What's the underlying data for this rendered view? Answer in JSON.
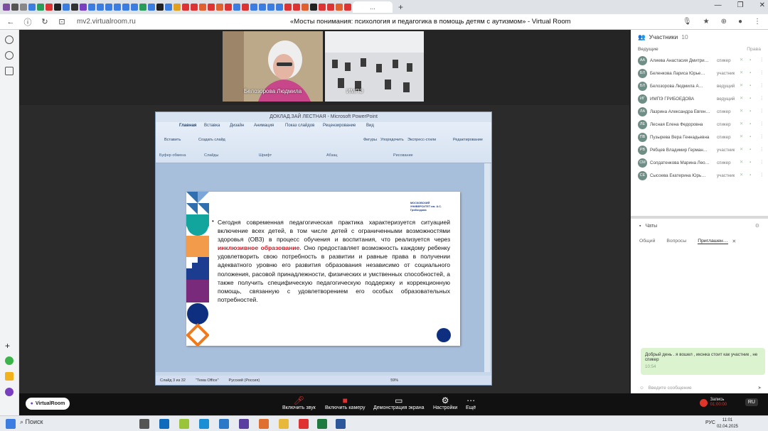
{
  "browser": {
    "tab_active_label": "…",
    "url": "mv2.virtualroom.ru",
    "page_title": "«Мосты понимания: психология и педагогика в помощь детям с аутизмом» - Virtual Room"
  },
  "video_tiles": [
    {
      "name": "Белозорова Людмила"
    },
    {
      "name": "ИМПЭ"
    }
  ],
  "ppt": {
    "window_title": "ДОКЛАД.ЗАЙ ЛЕСТНАЯ - Microsoft PowerPoint",
    "ribbon_tabs": [
      "Главная",
      "Вставка",
      "Дизайн",
      "Анимация",
      "Показ слайдов",
      "Рецензирование",
      "Вид"
    ],
    "ribbon_groups": [
      "Буфер обмена",
      "Слайды",
      "Шрифт",
      "Абзац",
      "Рисование",
      "Редактирование"
    ],
    "ribbon_buttons": {
      "paste": "Вставить",
      "create_slide": "Создать слайд",
      "figures": "Фигуры",
      "arrange": "Упорядочить",
      "express": "Экспресс-стили",
      "editing": "Редактирование"
    },
    "slide_logo": "МОСКОВСКИЙ УНИВЕРСИТЕТ им. А.С. Грибоедова",
    "slide_text_1": "Сегодня современная педагогическая практика характеризуется ситуацией включение всех детей, в том числе детей с ограниченными возможностями здоровья (ОВЗ) в процесс обучения и воспитания, что реализуется через ",
    "slide_text_highlight": "инклюзивное образование",
    "slide_text_2": ". Оно предоставляет возможность каждому ребенку удовлетворить свою потребность в развитии и равные права в получении адекватного уровню его развития образования независимо от социального положения, расовой принадлежности, физических и умственных способностей, а также получить специфическую педагогическую поддержку и коррекционную помощь, связанную с удовлетворением его особых образовательных потребностей.",
    "status": {
      "slide": "Слайд 3 из 32",
      "theme": "\"Тема Office\"",
      "lang": "Русский (Россия)",
      "zoom": "59%"
    }
  },
  "participants": {
    "title": "Участники",
    "count": "10",
    "section": "Ведущие",
    "section_right": "Права",
    "list": [
      {
        "initials": "АА",
        "name": "Алиева Анастасия Дмитри…",
        "role": "спикер",
        "color": "#6f8e86"
      },
      {
        "initials": "БЛ",
        "name": "Беленкова Лариса Юрье…",
        "role": "участник",
        "color": "#6f8e86"
      },
      {
        "initials": "БЛ",
        "name": "Белозорова Людмила А…",
        "role": "ведущий",
        "color": "#6f8e86"
      },
      {
        "initials": "ИГ",
        "name": "ИМПЭ ГРИБОЕДОВА",
        "role": "ведущий",
        "color": "#6f8e86"
      },
      {
        "initials": "ЛА",
        "name": "Лазрина Александра Евген…",
        "role": "спикер",
        "color": "#6f8e86"
      },
      {
        "initials": "ЛЕ",
        "name": "Лесная Елена Федоровна",
        "role": "спикер",
        "color": "#6f8e86"
      },
      {
        "initials": "ПВ",
        "name": "Пузырева Вера Геннадьевна",
        "role": "спикер",
        "color": "#6f8e86"
      },
      {
        "initials": "РВ",
        "name": "Рябцев Владимир Герман…",
        "role": "участник",
        "color": "#6f8e86"
      },
      {
        "initials": "СМ",
        "name": "Солдатенкова Марина Лео…",
        "role": "спикер",
        "color": "#6f8e86"
      },
      {
        "initials": "СЕ",
        "name": "Сысоева Екатерина Юрь…",
        "role": "участник",
        "color": "#6f8e86"
      }
    ]
  },
  "chat": {
    "title": "Чаты",
    "tabs": [
      "Общий",
      "Вопросы",
      "Приглашен…"
    ],
    "message": "Добрый день . я вошел , иконка стоит как участник , не спикер",
    "time": "10:54",
    "placeholder": "Введите сообщение"
  },
  "controls": {
    "logo": "VirtualRoom",
    "mic": "Включить звук",
    "cam": "Включить камеру",
    "screen": "Демонстрация экрана",
    "settings": "Настройки",
    "more": "Ещё",
    "record": "Запись",
    "record_time": "01:00:00",
    "lang": "RU"
  },
  "taskbar": {
    "search": "Поиск",
    "lang": "РУС",
    "time": "11:01",
    "date": "02.04.2025"
  }
}
